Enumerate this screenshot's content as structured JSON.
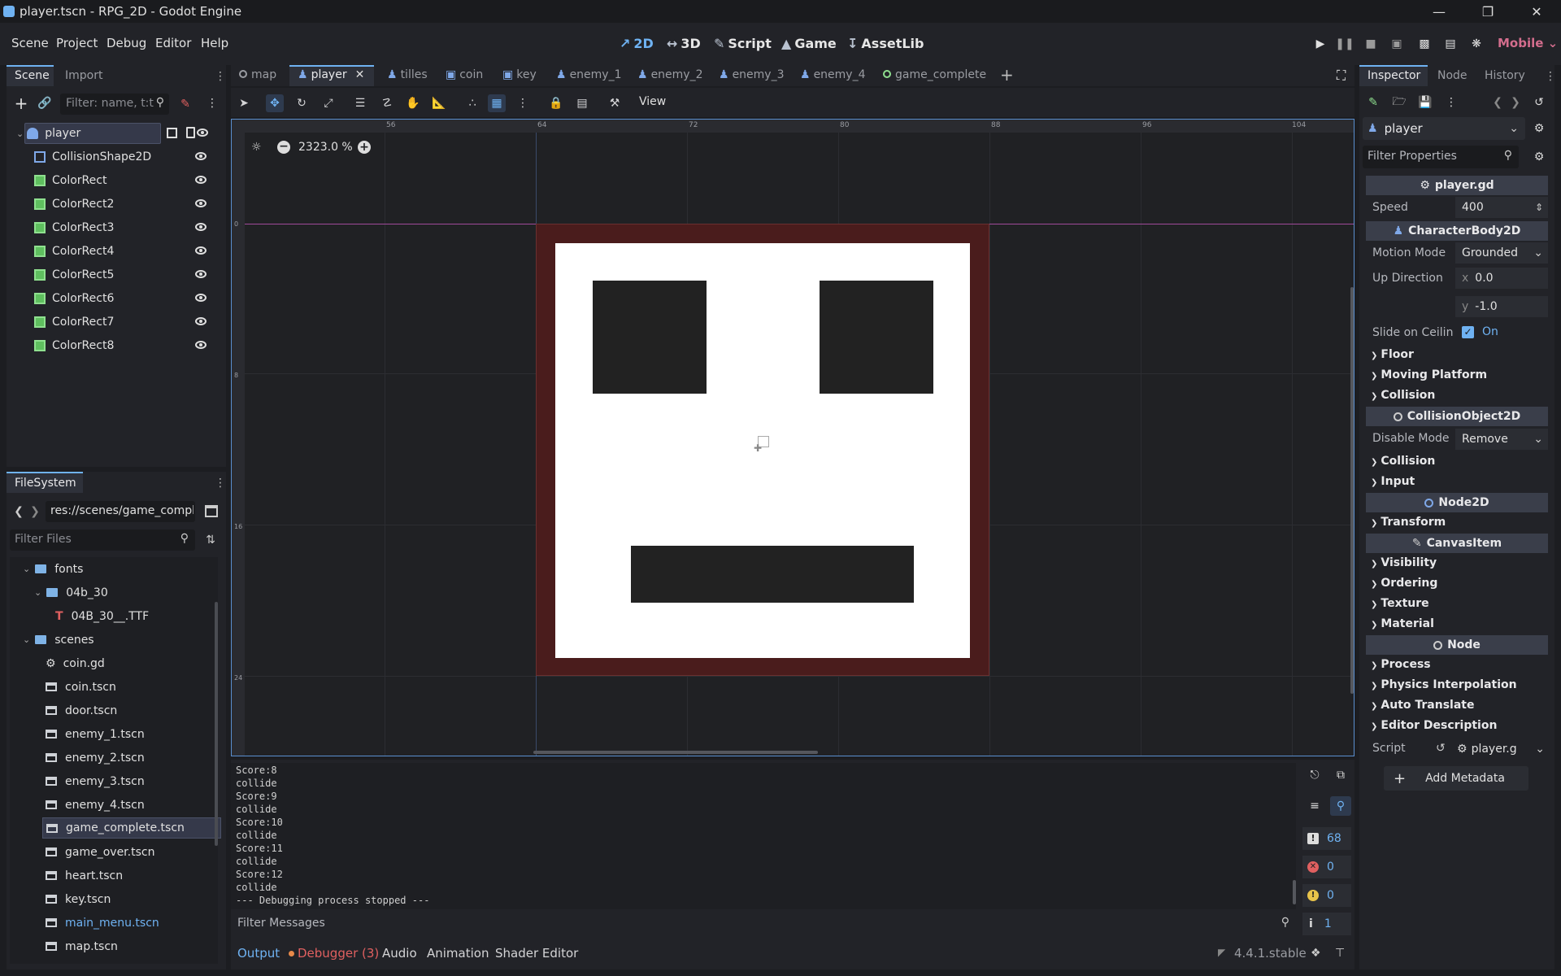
{
  "window": {
    "title": "player.tscn - RPG_2D - Godot Engine"
  },
  "menu": [
    "Scene",
    "Project",
    "Debug",
    "Editor",
    "Help"
  ],
  "workspaces": [
    {
      "label": "2D",
      "icon": "2d-icon"
    },
    {
      "label": "3D",
      "icon": "3d-icon"
    },
    {
      "label": "Script",
      "icon": "script-icon"
    },
    {
      "label": "Game",
      "icon": "game-icon"
    },
    {
      "label": "AssetLib",
      "icon": "assetlib-icon"
    }
  ],
  "renderer": "Mobile",
  "scene_dock": {
    "tabs": [
      "Scene",
      "Import"
    ],
    "filter_placeholder": "Filter: name, t:t",
    "nodes": [
      {
        "name": "player",
        "type": "root"
      },
      {
        "name": "CollisionShape2D",
        "type": "collision"
      },
      {
        "name": "ColorRect",
        "type": "colorrect"
      },
      {
        "name": "ColorRect2",
        "type": "colorrect"
      },
      {
        "name": "ColorRect3",
        "type": "colorrect"
      },
      {
        "name": "ColorRect4",
        "type": "colorrect"
      },
      {
        "name": "ColorRect5",
        "type": "colorrect"
      },
      {
        "name": "ColorRect6",
        "type": "colorrect"
      },
      {
        "name": "ColorRect7",
        "type": "colorrect"
      },
      {
        "name": "ColorRect8",
        "type": "colorrect"
      }
    ]
  },
  "filesystem": {
    "tab": "FileSystem",
    "path": "res://scenes/game_compl",
    "filter_placeholder": "Filter Files",
    "items": [
      {
        "name": "fonts",
        "kind": "folder"
      },
      {
        "name": "04b_30",
        "kind": "folder"
      },
      {
        "name": "04B_30__.TTF",
        "kind": "font"
      },
      {
        "name": "scenes",
        "kind": "folder"
      },
      {
        "name": "coin.gd",
        "kind": "script"
      },
      {
        "name": "coin.tscn",
        "kind": "scene"
      },
      {
        "name": "door.tscn",
        "kind": "scene"
      },
      {
        "name": "enemy_1.tscn",
        "kind": "scene"
      },
      {
        "name": "enemy_2.tscn",
        "kind": "scene"
      },
      {
        "name": "enemy_3.tscn",
        "kind": "scene"
      },
      {
        "name": "enemy_4.tscn",
        "kind": "scene"
      },
      {
        "name": "game_complete.tscn",
        "kind": "scene"
      },
      {
        "name": "game_over.tscn",
        "kind": "scene"
      },
      {
        "name": "heart.tscn",
        "kind": "scene"
      },
      {
        "name": "key.tscn",
        "kind": "scene"
      },
      {
        "name": "main_menu.tscn",
        "kind": "scene"
      },
      {
        "name": "map.tscn",
        "kind": "scene"
      }
    ]
  },
  "scene_tabs": [
    "map",
    "player",
    "tilles",
    "coin",
    "key",
    "enemy_1",
    "enemy_2",
    "enemy_3",
    "enemy_4",
    "game_complete"
  ],
  "viewport": {
    "zoom": "2323.0 %",
    "view_label": "View",
    "ruler_labels": [
      "56",
      "64",
      "72",
      "80",
      "88",
      "96",
      "104"
    ],
    "vruler_labels": [
      "0",
      "8",
      "16",
      "24"
    ]
  },
  "output": {
    "lines": [
      "Score:8",
      "collide",
      "Score:9",
      "collide",
      "Score:10",
      "collide",
      "Score:11",
      "collide",
      "Score:12",
      "collide",
      "--- Debugging process stopped ---"
    ],
    "filter_placeholder": "Filter Messages",
    "counts": {
      "messages": "68",
      "errors": "0",
      "warnings": "0",
      "info": "1"
    }
  },
  "bottom_tabs": [
    "Output",
    "Debugger (3)",
    "Audio",
    "Animation",
    "Shader Editor"
  ],
  "version": "4.4.1.stable",
  "inspector": {
    "tabs": [
      "Inspector",
      "Node",
      "History"
    ],
    "object": "player",
    "filter_placeholder": "Filter Properties",
    "script_section": "player.gd",
    "speed_label": "Speed",
    "speed_value": "400",
    "cb_section": "CharacterBody2D",
    "motion_mode_label": "Motion Mode",
    "motion_mode_value": "Grounded",
    "up_direction_label": "Up Direction",
    "up_x": "0.0",
    "up_y": "-1.0",
    "slide_label": "Slide on Ceilin",
    "slide_value": "On",
    "cats1": [
      "Floor",
      "Moving Platform",
      "Collision"
    ],
    "co_section": "CollisionObject2D",
    "disable_mode_label": "Disable Mode",
    "disable_mode_value": "Remove",
    "cats2": [
      "Collision",
      "Input"
    ],
    "n2d_section": "Node2D",
    "cats3": [
      "Transform"
    ],
    "ci_section": "CanvasItem",
    "cats4": [
      "Visibility",
      "Ordering",
      "Texture",
      "Material"
    ],
    "node_section": "Node",
    "cats5": [
      "Process",
      "Physics Interpolation",
      "Auto Translate",
      "Editor Description"
    ],
    "script_label": "Script",
    "script_value": "player.g",
    "add_metadata": "Add Metadata"
  },
  "colors": {
    "accent": "#6fb2f2",
    "selected": "#35394a",
    "canvas": "#202124",
    "sprite_border": "#4a1c1c"
  }
}
